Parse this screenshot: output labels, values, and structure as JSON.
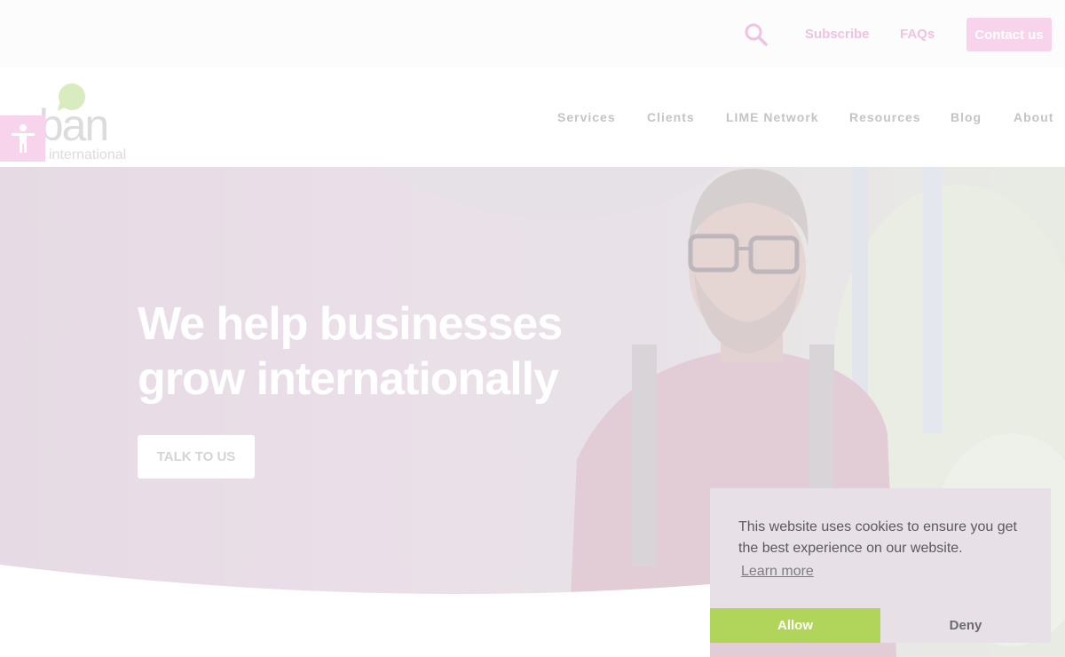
{
  "topbar": {
    "search_icon": "search-icon",
    "subscribe": "Subscribe",
    "faqs": "FAQs",
    "contact": "Contact us"
  },
  "logo": {
    "text": "aban",
    "subtext": "international"
  },
  "accessibility": {
    "icon": "accessibility-person-icon"
  },
  "nav": {
    "items": [
      "Services",
      "Clients",
      "LIME Network",
      "Resources",
      "Blog",
      "About"
    ]
  },
  "hero": {
    "title_line1": "We help businesses",
    "title_line2": "grow internationally",
    "cta": "TALK TO US"
  },
  "cookie": {
    "message": "This website uses cookies to ensure you get the best experience on our website.",
    "learn_more": "Learn more",
    "allow": "Allow",
    "deny": "Deny"
  },
  "colors": {
    "brand_pink": "#f7d4ec",
    "brand_green": "#b1d55a",
    "link_pink": "#efc3e2"
  }
}
